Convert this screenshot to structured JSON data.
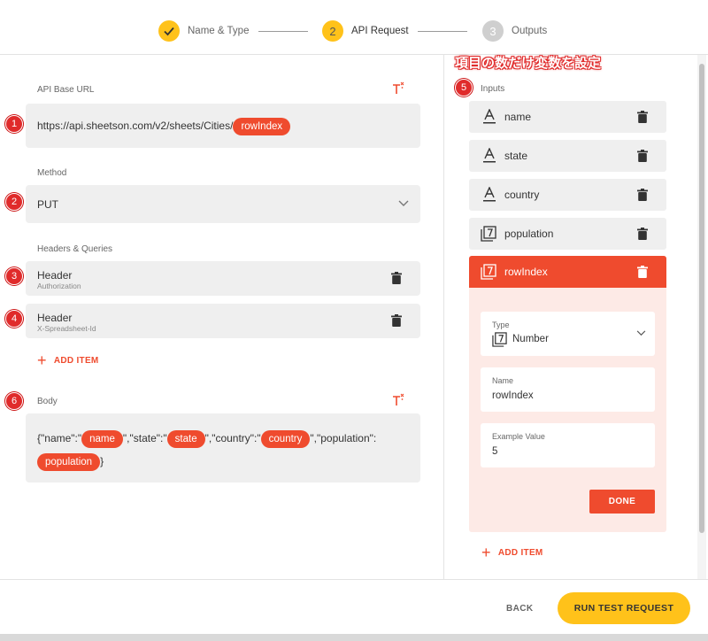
{
  "stepper": {
    "steps": [
      {
        "label": "Name & Type",
        "number": "",
        "state": "done"
      },
      {
        "label": "API Request",
        "number": "2",
        "state": "current"
      },
      {
        "label": "Outputs",
        "number": "3",
        "state": "todo"
      }
    ]
  },
  "annotation": {
    "text": "項目の数だけ変数を設定",
    "badges": [
      "1",
      "2",
      "3",
      "4",
      "5",
      "6"
    ]
  },
  "api_base_url": {
    "label": "API Base URL",
    "value_prefix": "https://api.sheetson.com/v2/sheets/Cities/",
    "variable": "rowIndex"
  },
  "method": {
    "label": "Method",
    "value": "PUT"
  },
  "headers": {
    "label": "Headers & Queries",
    "items": [
      {
        "title": "Header",
        "key": "Authorization"
      },
      {
        "title": "Header",
        "key": "X-Spreadsheet-Id"
      }
    ],
    "add_label": "ADD ITEM"
  },
  "body": {
    "label": "Body",
    "t1": "{\"name\":\"",
    "v1": "name",
    "t2": "\",\"state\":\"",
    "v2": "state",
    "t3": "\",\"country\":\"",
    "v3": "country",
    "t4": "\",\"population\":",
    "v4": "population",
    "t5": "}"
  },
  "inputs": {
    "label": "Inputs",
    "items": [
      {
        "name": "name",
        "type_icon": "text-icon"
      },
      {
        "name": "state",
        "type_icon": "text-icon"
      },
      {
        "name": "country",
        "type_icon": "text-icon"
      },
      {
        "name": "population",
        "type_icon": "number-icon"
      }
    ],
    "selected": {
      "name": "rowIndex",
      "type_icon": "number-icon",
      "type_label": "Type",
      "type_value": "Number",
      "name_label": "Name",
      "name_value": "rowIndex",
      "example_label": "Example Value",
      "example_value": "5",
      "done_label": "DONE"
    },
    "add_label": "ADD ITEM"
  },
  "footer": {
    "back_label": "BACK",
    "run_label": "RUN TEST REQUEST"
  },
  "colors": {
    "accent": "#ef4b2e",
    "primary": "#ffc21a",
    "badge": "#e02b2b"
  }
}
